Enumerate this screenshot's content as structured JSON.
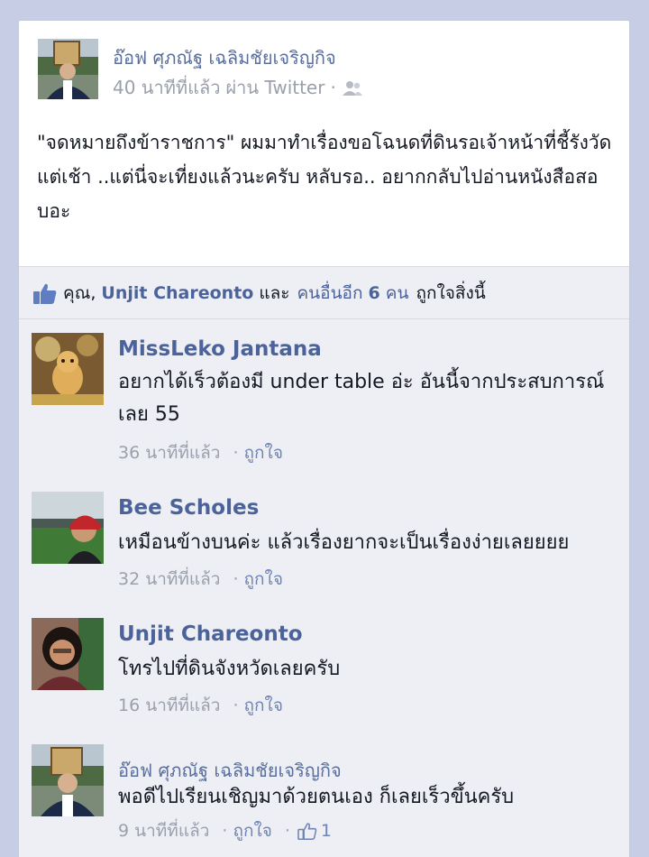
{
  "post": {
    "author": "อ๊อฟ ศุภณัฐ เฉลิมชัยเจริญกิจ",
    "time": "40 นาทีที่แล้ว",
    "via": "ผ่าน Twitter",
    "audience_icon": "friends-icon",
    "text": "\"จดหมายถึงข้าราชการ\" ผมมาทำเรื่องขอโฉนดที่ดินรอเจ้าหน้าที่ชี้รังวัดแต่เช้า ..แต่นี่จะเที่ยงแล้วนะครับ หลับรอ.. อยากกลับไปอ่านหนังสือสอบอะ"
  },
  "likes": {
    "icon": "thumbs-up-icon",
    "prefix": "คุณ,",
    "name": "Unjit Chareonto",
    "and": "และ",
    "others_prefix": "คนอื่นอีก",
    "others_count": "6",
    "others_suffix": "คน",
    "suffix": "ถูกใจสิ่งนี้"
  },
  "comments": [
    {
      "name": "MissLeko Jantana",
      "text": "อยากได้เร็วต้องมี under table อ่ะ อันนี้จากประสบการณ์ เลย 55",
      "time": "36 นาทีที่แล้ว",
      "like_label": "ถูกใจ"
    },
    {
      "name": "Bee Scholes",
      "text": "เหมือนข้างบนค่ะ แล้วเรื่องยากจะเป็นเรื่องง่ายเลยยยย",
      "time": "32 นาทีที่แล้ว",
      "like_label": "ถูกใจ"
    },
    {
      "name": "Unjit Chareonto",
      "text": "โทรไปที่ดินจังหวัดเลยครับ",
      "time": "16 นาทีที่แล้ว",
      "like_label": "ถูกใจ"
    },
    {
      "name": "อ๊อฟ ศุภณัฐ เฉลิมชัยเจริญกิจ",
      "text": "พอดีไปเรียนเชิญมาด้วยตนเอง ก็เลยเร็วขึ้นครับ",
      "time": "9 นาทีที่แล้ว",
      "like_label": "ถูกใจ",
      "like_count": "1"
    }
  ],
  "colors": {
    "link": "#4b639a",
    "page_bg": "#c7cde5",
    "card_bg": "#edeff5",
    "meta": "#9aa0ac"
  }
}
